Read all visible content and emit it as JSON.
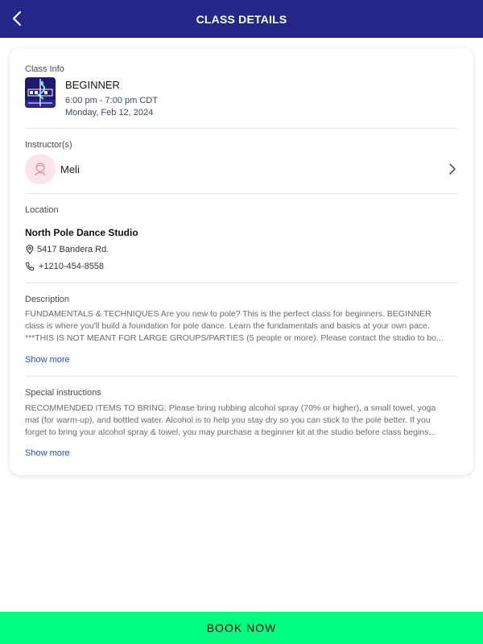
{
  "header": {
    "title": "CLASS DETAILS",
    "back_icon": "chevron-left-icon"
  },
  "class_info": {
    "label": "Class Info",
    "name": "BEGINNER",
    "time": "6:00 pm - 7:00 pm CDT",
    "date": "Monday, Feb 12, 2024"
  },
  "instructor": {
    "label": "Instructor(s)",
    "name": "Meli",
    "avatar_icon": "person-icon"
  },
  "location": {
    "label": "Location",
    "studio": "North Pole Dance Studio",
    "address": "5417 Bandera Rd.",
    "phone": "+1210-454-8558"
  },
  "description": {
    "label": "Description",
    "lines": [
      "FUNDAMENTALS & TECHNIQUES    Are you new to pole? This is the perfect class for beginners. BEGINNER",
      "class is where you'll build a foundation for pole dance. Learn the fundamentals and basics at your own pace.",
      "***THIS IS NOT MEANT FOR LARGE GROUPS/PARTIES (5 people or more). Please contact the studio to bo..."
    ],
    "show_more": "Show more"
  },
  "special_instructions": {
    "label": "Special instructions",
    "lines": [
      "RECOMMENDED ITEMS TO BRING: Please bring rubbing alcohol spray (70% or higher), a small towel, yoga",
      "mat (for warm-up), and bottled water. Alcohol is to help you stay dry so you can stick to the pole better. If you",
      "forget to bring your alcohol spray & towel, you may purchase a beginner kit at the studio before class begins..."
    ],
    "show_more": "Show more"
  },
  "footer": {
    "book_label": "BOOK NOW"
  },
  "colors": {
    "header_bg": "#26268a",
    "book_button_bg": "#00ff7f",
    "link": "#1f4fd1",
    "avatar_bg": "#fae6ea"
  }
}
